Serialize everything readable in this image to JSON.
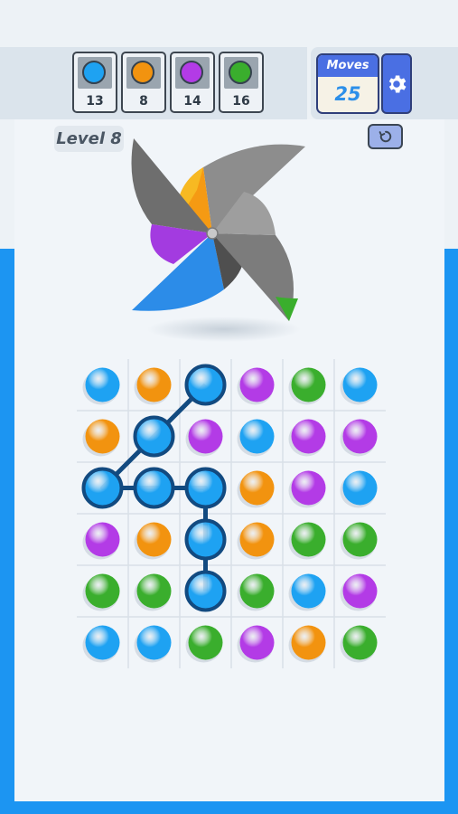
{
  "colors": {
    "blue": "#1ea2f2",
    "orange": "#f2930f",
    "purple": "#b33be6",
    "green": "#3aae2d",
    "path": "#124a80",
    "grid_line": "#d9e0e7"
  },
  "goals": [
    {
      "color": "blue",
      "count": "13"
    },
    {
      "color": "orange",
      "count": "8"
    },
    {
      "color": "purple",
      "count": "14"
    },
    {
      "color": "green",
      "count": "16"
    }
  ],
  "moves": {
    "label": "Moves",
    "value": "25"
  },
  "settings": {
    "icon": "gear-icon"
  },
  "level": {
    "label": "Level 8"
  },
  "restart": {
    "icon": "restart-icon"
  },
  "pinwheel": {
    "icon": "pinwheel-icon"
  },
  "board": {
    "rows": [
      [
        "blue",
        "orange",
        "blue",
        "purple",
        "green",
        "blue"
      ],
      [
        "orange",
        "blue",
        "purple",
        "blue",
        "purple",
        "purple"
      ],
      [
        "blue",
        "blue",
        "blue",
        "orange",
        "purple",
        "blue"
      ],
      [
        "purple",
        "orange",
        "blue",
        "orange",
        "green",
        "green"
      ],
      [
        "green",
        "green",
        "blue",
        "green",
        "blue",
        "purple"
      ],
      [
        "blue",
        "blue",
        "green",
        "purple",
        "orange",
        "green"
      ]
    ],
    "selected_path": [
      [
        0,
        2
      ],
      [
        1,
        1
      ],
      [
        2,
        0
      ],
      [
        2,
        1
      ],
      [
        2,
        2
      ],
      [
        3,
        2
      ],
      [
        4,
        2
      ]
    ]
  }
}
